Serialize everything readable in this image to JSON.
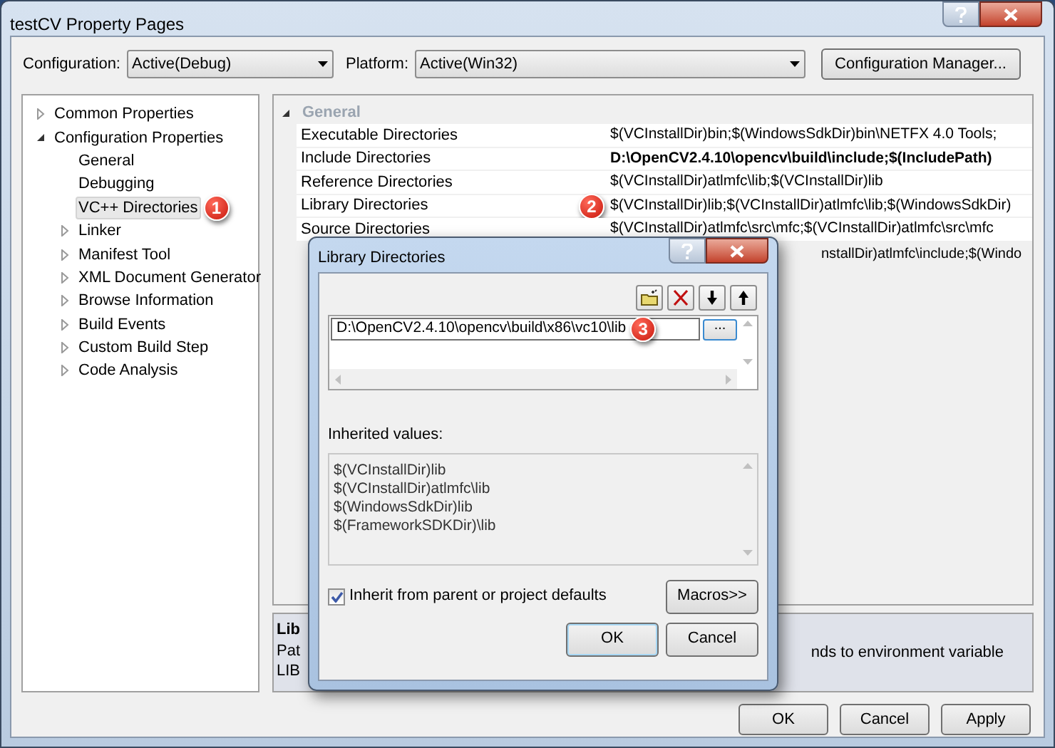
{
  "window": {
    "title": "testCV Property Pages"
  },
  "toolbar": {
    "configuration_label": "Configuration:",
    "configuration_value": "Active(Debug)",
    "platform_label": "Platform:",
    "platform_value": "Active(Win32)",
    "manager_button": "Configuration Manager..."
  },
  "tree": [
    {
      "label": "Common Properties",
      "expandable": true,
      "expanded": false,
      "selected": false
    },
    {
      "label": "Configuration Properties",
      "expandable": true,
      "expanded": true,
      "selected": false,
      "children": [
        {
          "label": "General",
          "selected": false
        },
        {
          "label": "Debugging",
          "selected": false
        },
        {
          "label": "VC++ Directories",
          "selected": true,
          "badge": "1"
        },
        {
          "label": "Linker",
          "expandable": true,
          "expanded": false,
          "selected": false
        },
        {
          "label": "Manifest Tool",
          "expandable": true,
          "expanded": false,
          "selected": false
        },
        {
          "label": "XML Document Generator",
          "expandable": true,
          "expanded": false,
          "selected": false
        },
        {
          "label": "Browse Information",
          "expandable": true,
          "expanded": false,
          "selected": false
        },
        {
          "label": "Build Events",
          "expandable": true,
          "expanded": false,
          "selected": false
        },
        {
          "label": "Custom Build Step",
          "expandable": true,
          "expanded": false,
          "selected": false
        },
        {
          "label": "Code Analysis",
          "expandable": true,
          "expanded": false,
          "selected": false
        }
      ]
    }
  ],
  "property_grid": {
    "category": {
      "label": "General",
      "expanded": true
    },
    "rows": [
      {
        "kind": "full",
        "name": "Executable Directories",
        "value": "$(VCInstallDir)bin;$(WindowsSdkDir)bin\\NETFX 4.0 Tools;",
        "bold": false
      },
      {
        "kind": "full",
        "name": "Include Directories",
        "value": "D:\\OpenCV2.4.10\\opencv\\build\\include;$(IncludePath)",
        "bold": true
      },
      {
        "kind": "full",
        "name": "Reference Directories",
        "value": "$(VCInstallDir)atlmfc\\lib;$(VCInstallDir)lib",
        "bold": false
      },
      {
        "kind": "full",
        "name": "Library Directories",
        "value": "$(VCInstallDir)lib;$(VCInstallDir)atlmfc\\lib;$(WindowsSdkDir)",
        "bold": false,
        "badge": "2"
      },
      {
        "kind": "full",
        "name": "Source Directories",
        "value": "$(VCInstallDir)atlmfc\\src\\mfc;$(VCInstallDir)atlmfc\\src\\mfc",
        "bold": false
      },
      {
        "kind": "partial",
        "value": "nstallDir)atlmfc\\include;$(Windo",
        "bold": false
      }
    ]
  },
  "description": {
    "title": "Lib",
    "lines": [
      "Pat",
      "LIB"
    ],
    "trailing": "nds to environment variable"
  },
  "buttons": [
    {
      "label": "OK"
    },
    {
      "label": "Cancel"
    },
    {
      "label": "Apply"
    }
  ],
  "dialog": {
    "title": "Library Directories",
    "entries": [
      {
        "value": "D:\\OpenCV2.4.10\\opencv\\build\\x86\\vc10\\lib",
        "badge": "3"
      }
    ],
    "browse_button": "...",
    "inherited_label": "Inherited values:",
    "inherited_values": [
      "$(VCInstallDir)lib",
      "$(VCInstallDir)atlmfc\\lib",
      "$(WindowsSdkDir)lib",
      "$(FrameworkSDKDir)\\lib"
    ],
    "inherit_checkbox": {
      "label": "Inherit from parent or project defaults",
      "checked": true
    },
    "macros_button": "Macros>>",
    "buttons": [
      {
        "label": "OK",
        "default": true
      },
      {
        "label": "Cancel",
        "default": false
      }
    ]
  }
}
